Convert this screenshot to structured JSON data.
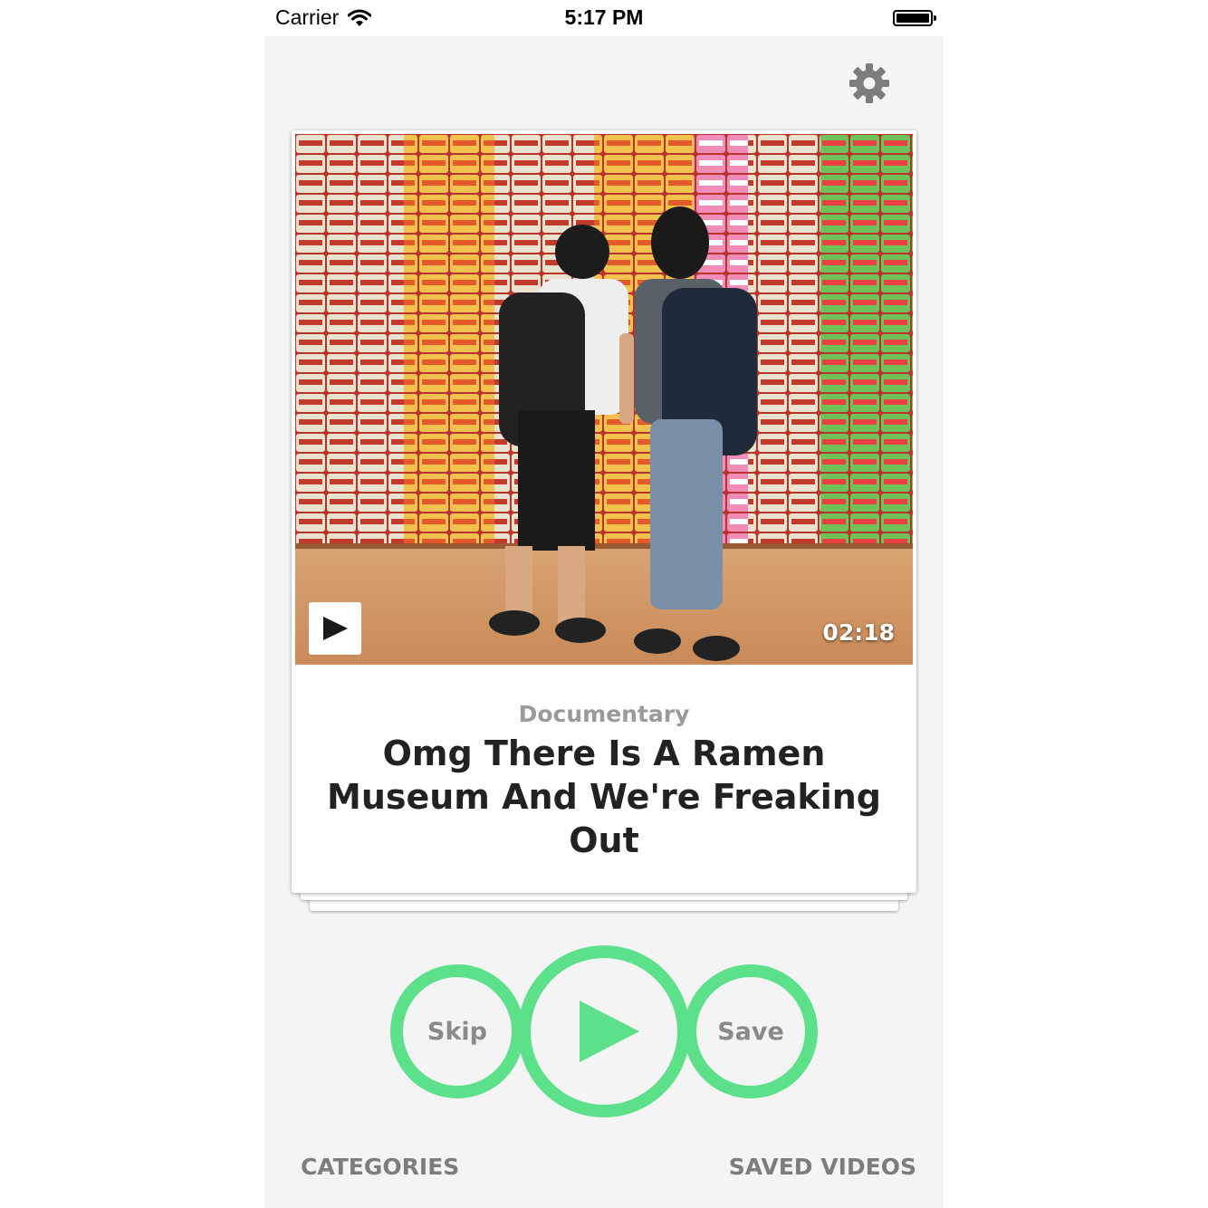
{
  "status_bar": {
    "carrier": "Carrier",
    "time": "5:17 PM"
  },
  "video_card": {
    "duration": "02:18",
    "category": "Documentary",
    "title": "Omg There Is A Ramen Museum And We're Freaking Out"
  },
  "controls": {
    "skip_label": "Skip",
    "save_label": "Save",
    "accent_color": "#5ce08a"
  },
  "bottom_nav": {
    "categories_label": "CATEGORIES",
    "saved_label": "SAVED VIDEOS"
  },
  "icons": [
    "wifi-icon",
    "battery-icon",
    "gear-icon",
    "play-icon",
    "big-play-icon"
  ]
}
